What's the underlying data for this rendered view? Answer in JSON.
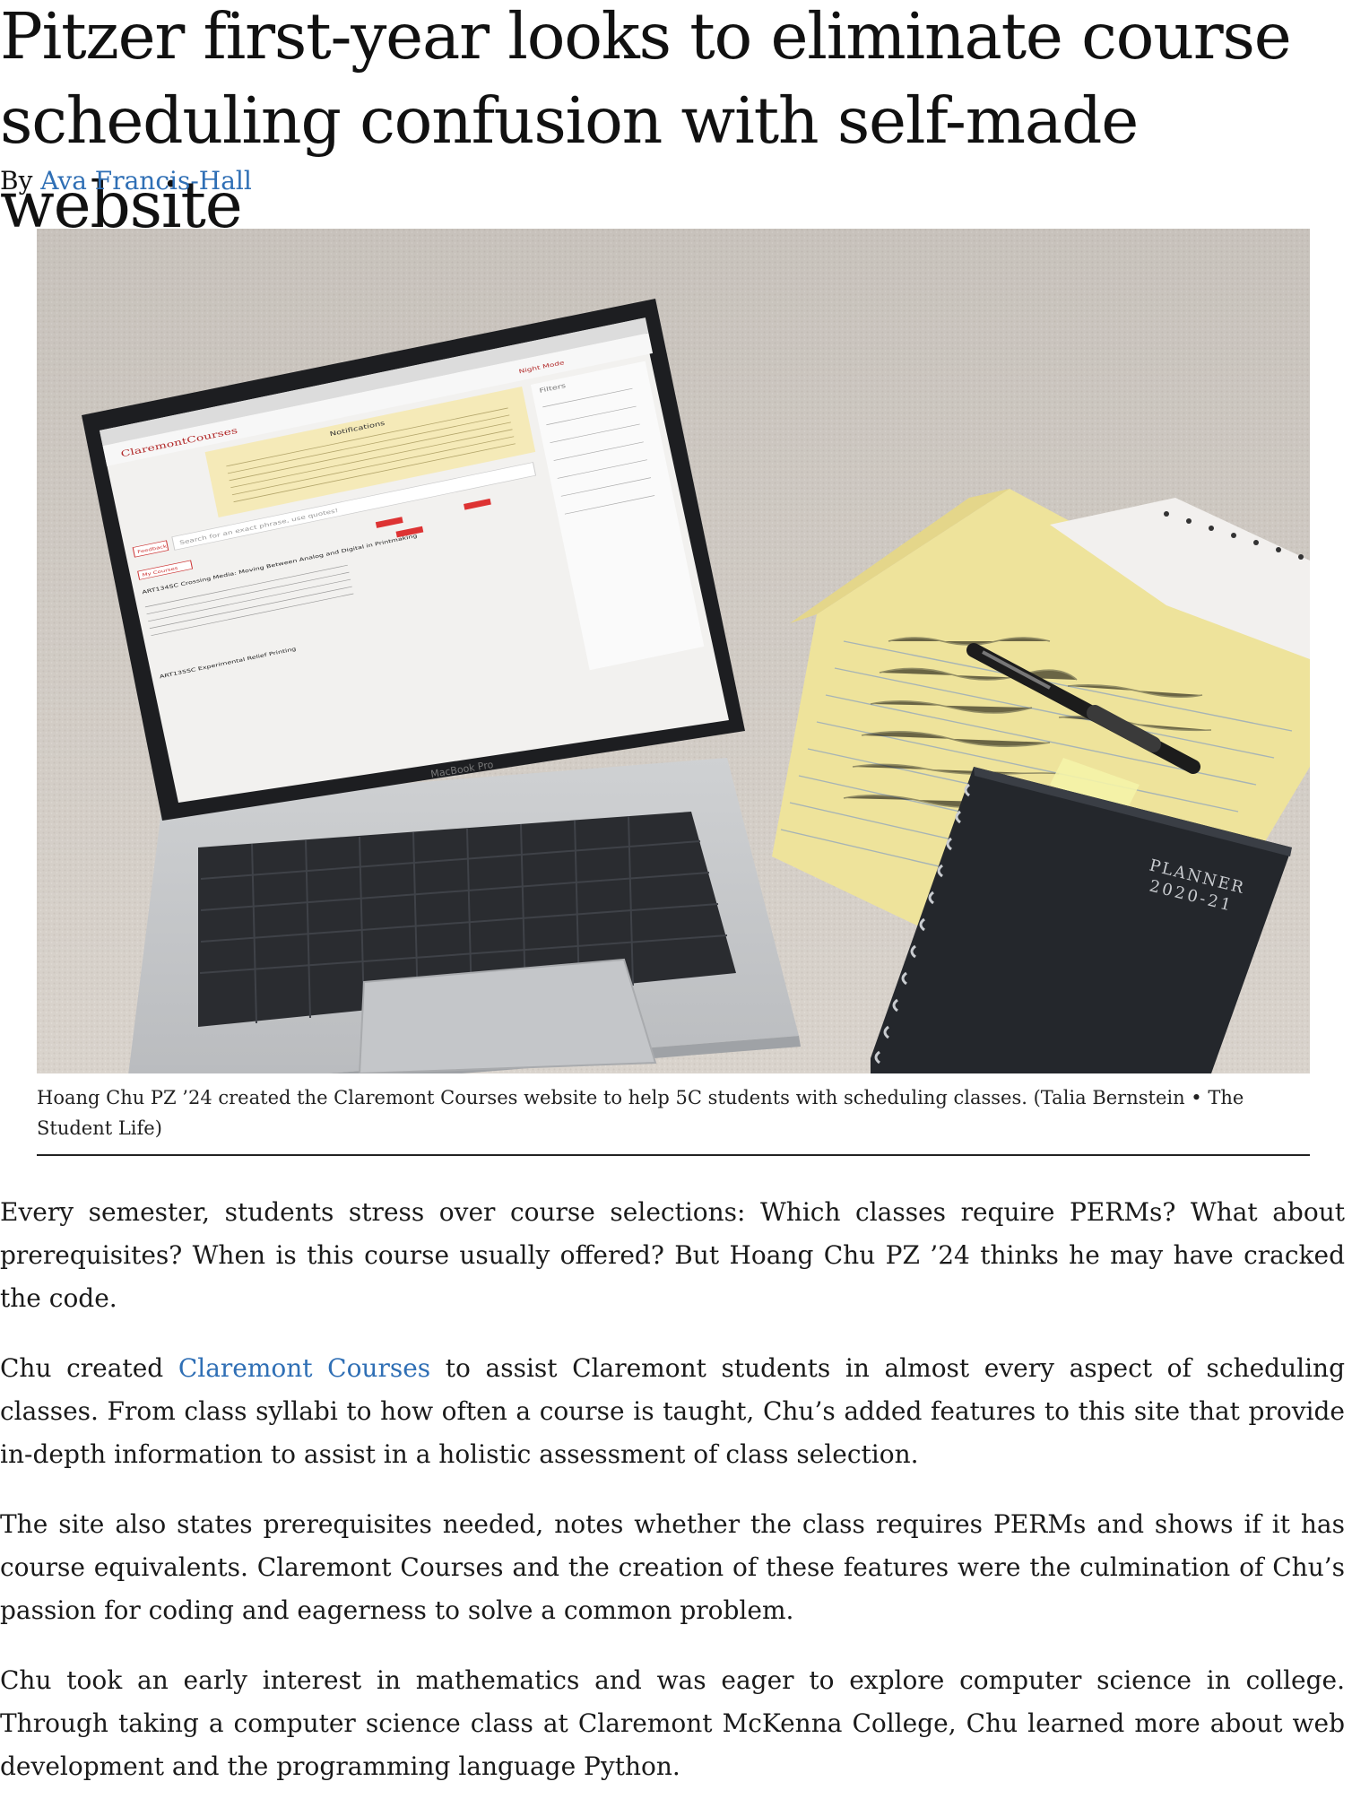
{
  "article": {
    "headline": "Pitzer first-year looks to eliminate course scheduling confusion with self-made website",
    "byline_prefix": "By ",
    "author": "Ava Francis-Hall"
  },
  "figure": {
    "caption": "Hoang Chu PZ ’24 created the Claremont Courses website to help 5C students with scheduling classes. (Talia Bernstein • The Student Life)",
    "screen": {
      "site_name": "ClaremontCourses",
      "notifications_title": "Notifications",
      "search_placeholder": "Search for an exact phrase, use quotes!",
      "feedback_label": "Feedback",
      "my_courses_label": "My Courses",
      "course_title": "ART134SC Crossing Media: Moving Between Analog and Digital in Printmaking",
      "next_course": "ART135SC Experimental Relief Printing",
      "filters_label": "Filters",
      "night_mode_label": "Night Mode"
    },
    "planner_label": "PLANNER",
    "planner_year": "2020-21",
    "laptop_label": "MacBook Pro"
  },
  "body": {
    "p1": "Every semester, students stress over course selections: Which classes require PERMs? What about prerequisites? When is this course usually offered? But Hoang Chu PZ ’24 thinks he may have cracked the code.",
    "p2_before": "Chu created ",
    "p2_link": "Claremont Courses",
    "p2_after": " to assist Claremont students in almost every aspect of scheduling classes. From class syllabi to how often a course is taught, Chu’s added features to this site that provide in-depth information to assist in a holistic assessment of class selection.",
    "p3": "The site also states prerequisites needed, notes whether the class requires PERMs and shows if it has course equivalents. Claremont Courses and the creation of these features were the culmination of Chu’s passion for coding and eagerness to solve a common problem.",
    "p4": "Chu took an early interest in mathematics and was eager to explore computer science in college. Through taking a computer science class at Claremont McKenna College, Chu learned more about web development and the programming language Python."
  },
  "colors": {
    "link": "#2f6fb5",
    "carpet": "#d8d2cb",
    "notepad": "#efe39a",
    "planner": "#23262b"
  }
}
